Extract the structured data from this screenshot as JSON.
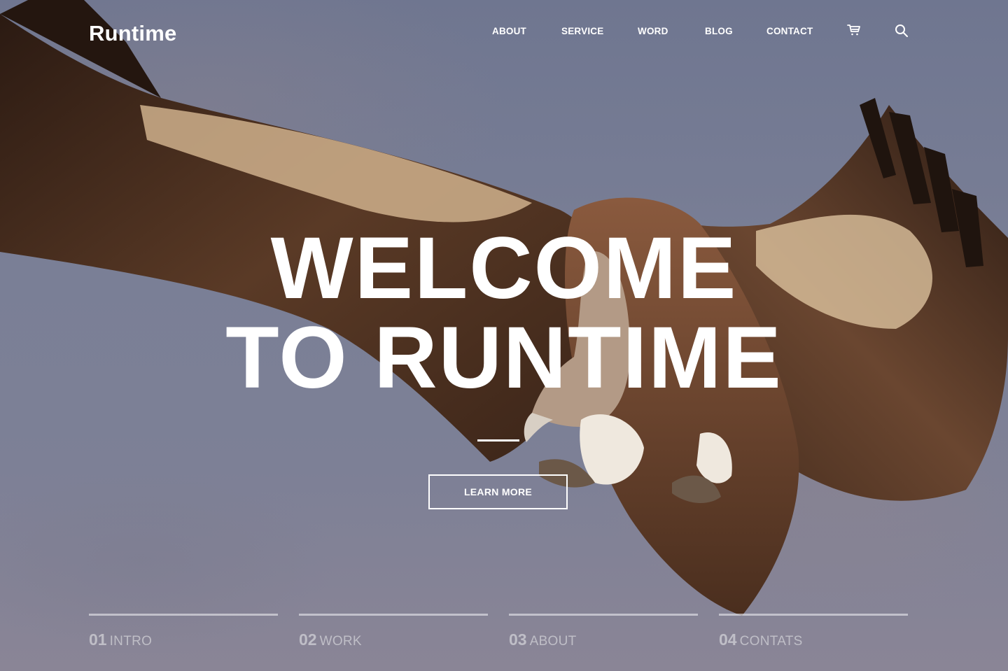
{
  "brand": {
    "logo_text": "Runtime"
  },
  "nav": {
    "items": [
      {
        "label": "ABOUT"
      },
      {
        "label": "SERVICE"
      },
      {
        "label": "WORD"
      },
      {
        "label": "BLOG"
      },
      {
        "label": "CONTACT"
      }
    ],
    "icons": {
      "cart": "cart-icon",
      "search": "search-icon"
    }
  },
  "hero": {
    "title_line1": "WELCOME",
    "title_line2": "TO RUNTIME",
    "button_label": "LEARN MORE",
    "background": "vulture in flight, cloudy sky"
  },
  "sections": [
    {
      "number": "01",
      "label": "INTRO"
    },
    {
      "number": "02",
      "label": "WORK"
    },
    {
      "number": "03",
      "label": "ABOUT"
    },
    {
      "number": "04",
      "label": "CONTATS"
    }
  ],
  "colors": {
    "text": "#ffffff",
    "sky": "#747a92",
    "wing_dark": "#3a2418",
    "wing_light": "#d9c2a0"
  }
}
